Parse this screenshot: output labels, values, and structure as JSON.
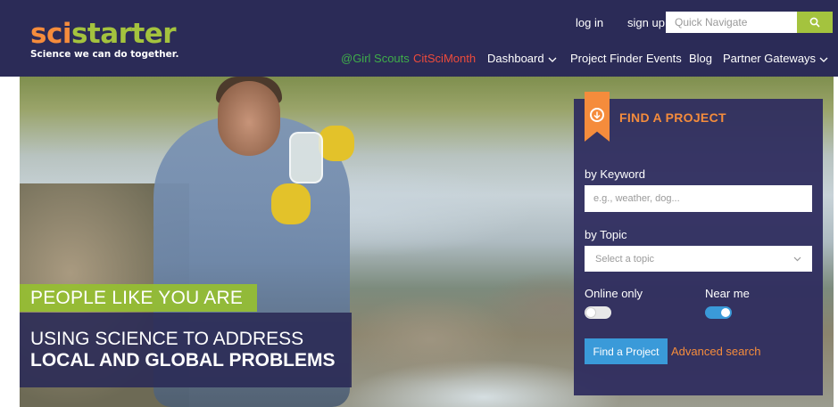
{
  "brand": {
    "logo_sci": "sci",
    "logo_starter": "starter",
    "tagline": "Science we can do together.",
    "colors": {
      "orange": "#f58c3c",
      "green": "#a4c33e",
      "navy": "#2b2b57",
      "blue": "#3a9ad9"
    }
  },
  "header": {
    "login_label": "log in",
    "signup_label": "sign up",
    "search_placeholder": "Quick Navigate",
    "search_icon": "search-icon"
  },
  "nav": {
    "items": [
      {
        "label": "@Girl Scouts"
      },
      {
        "label": "CitSciMonth"
      },
      {
        "label": "Dashboard",
        "has_dropdown": true
      },
      {
        "label": "Project Finder"
      },
      {
        "label": "Events"
      },
      {
        "label": "Blog"
      },
      {
        "label": "Partner Gateways",
        "has_dropdown": true
      }
    ]
  },
  "hero": {
    "headline_1": "PEOPLE LIKE YOU ARE",
    "headline_2": "USING SCIENCE TO ADDRESS",
    "headline_3": "LOCAL AND GLOBAL PROBLEMS"
  },
  "finder": {
    "title": "FIND A PROJECT",
    "ribbon_icon": "arrow-down-circle-icon",
    "keyword_label": "by Keyword",
    "keyword_placeholder": "e.g., weather, dog...",
    "topic_label": "by Topic",
    "topic_placeholder": "Select a topic",
    "online_label": "Online only",
    "online_on": false,
    "near_label": "Near me",
    "near_on": true,
    "button_label": "Find a Project",
    "advanced_label": "Advanced search"
  }
}
